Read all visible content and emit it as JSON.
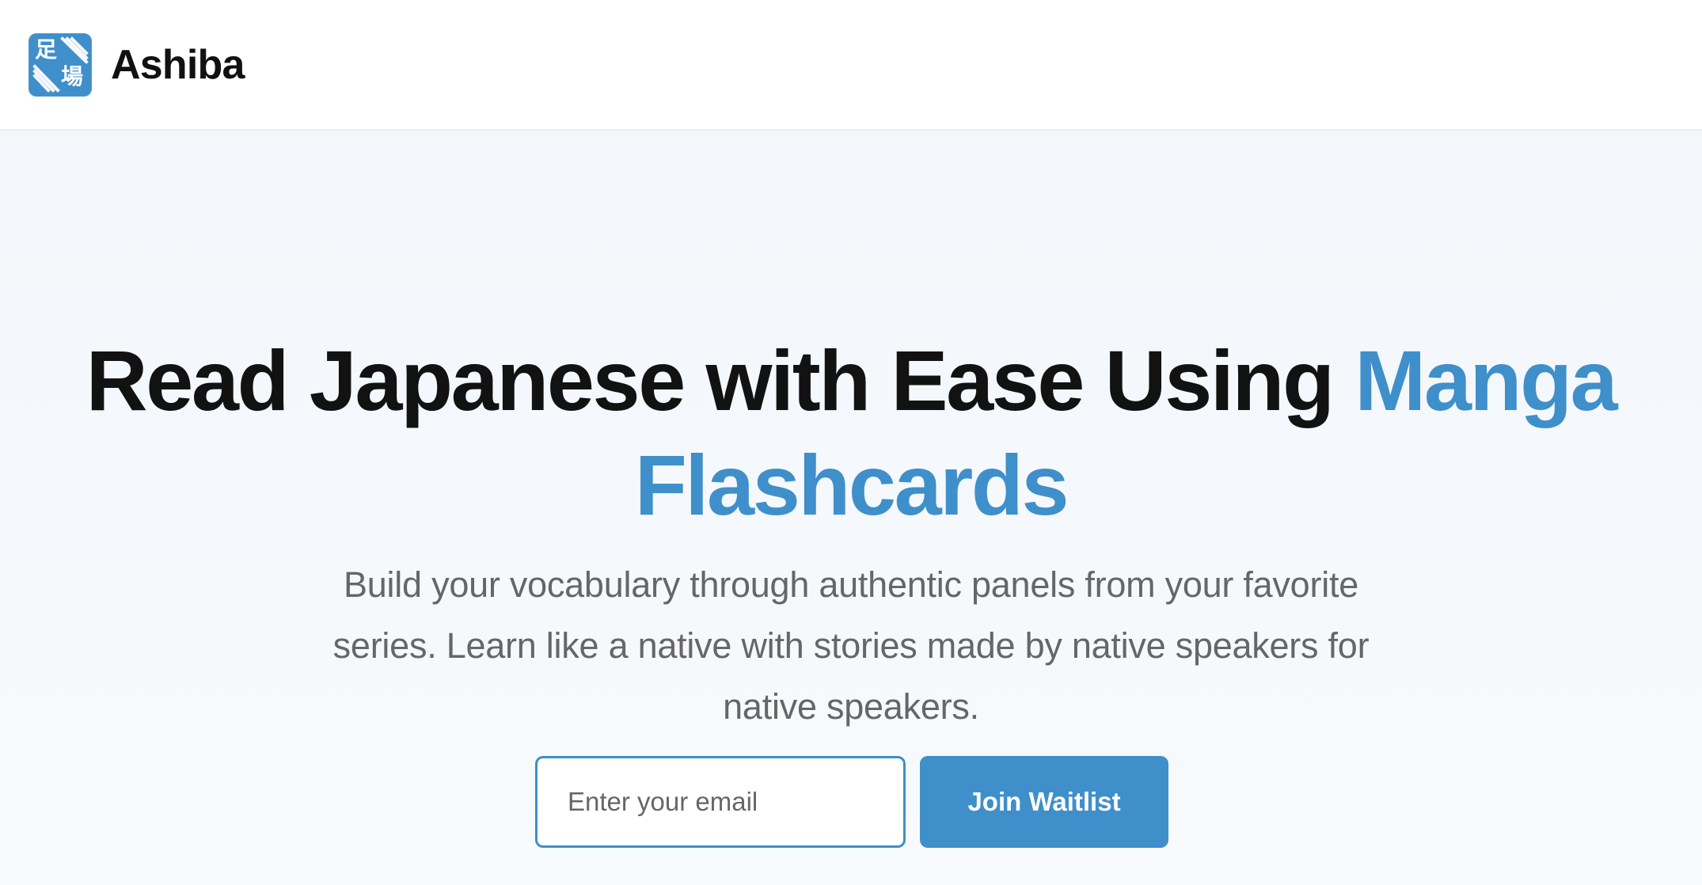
{
  "header": {
    "brand_name": "Ashiba",
    "logo": {
      "icon": "ashiba-logo-icon",
      "kanji_top": "足",
      "kanji_bottom": "場",
      "background_color": "#3f8fca"
    }
  },
  "hero": {
    "title_primary": "Read Japanese with Ease Using",
    "title_accent_first_line": "Manga",
    "title_accent_second_line": "Flashcards",
    "subtitle": "Build your vocabulary through authentic panels from your favorite series. Learn like a native with stories made by native speakers for native speakers.",
    "email_placeholder": "Enter your email",
    "button_label": "Join Waitlist",
    "accent_color": "#3f8fca",
    "text_color": "#121212",
    "subtitle_color": "#666666"
  }
}
